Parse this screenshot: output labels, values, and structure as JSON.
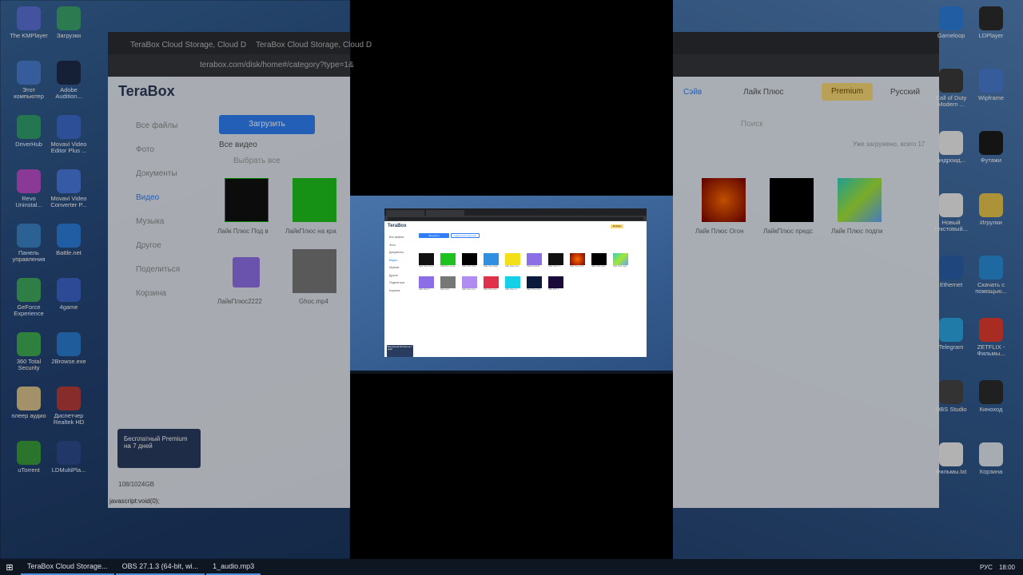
{
  "background": {
    "left_tabs": [
      "TeraBox Cloud Storage, Cloud D",
      "TeraBox Cloud Storage, Cloud D"
    ],
    "left_url": "terabox.com/disk/home#/category?type=1&",
    "left_logo": "TeraBox",
    "left_sidebar": [
      "Все файлы",
      "Фото",
      "Документы",
      "Видео",
      "Музыка",
      "Другое",
      "Поделиться",
      "Корзина"
    ],
    "left_upload": "Загрузить",
    "left_video_all": "Все видео",
    "left_select_all": "Выбрать все",
    "left_captions": [
      "Лайк Плюс Под в",
      "ЛайкПлюс на кра",
      "ЛайкПлюс2222",
      "Ghoc.mp4"
    ],
    "left_promo": "Бесплатный Premium на 7 дней",
    "left_storage": "108/1024GB",
    "left_status": "javascript:void(0);",
    "right_links": [
      "Сэйв"
    ],
    "right_user": "Лайк Плюс",
    "right_premium": "Premium",
    "right_lang": "Русский",
    "right_search": "Поиск",
    "right_loaded": "Уже загружено, всего 17",
    "right_captions": [
      "Лайк Плюс Огон",
      "ЛайкПлюс предс",
      "Лайк Плюс подпи"
    ]
  },
  "desktop_left": [
    {
      "label": "The KMPlayer"
    },
    {
      "label": "Загрузки"
    },
    {
      "label": "Этот компьютер"
    },
    {
      "label": "Adobe Audition..."
    },
    {
      "label": "DriverHub"
    },
    {
      "label": "Movavi Video Editor Plus ..."
    },
    {
      "label": "Revo Uninstal..."
    },
    {
      "label": "Movavi Video Converter P..."
    },
    {
      "label": "Панель управления"
    },
    {
      "label": "Battle.net"
    },
    {
      "label": "GeForce Experience"
    },
    {
      "label": "4game"
    },
    {
      "label": "360 Total Security"
    },
    {
      "label": "2Browse.exe"
    },
    {
      "label": "плеер аудио"
    },
    {
      "label": "Диспетчер Realtek HD"
    },
    {
      "label": "uTorrent"
    },
    {
      "label": "LDMultiPla..."
    }
  ],
  "desktop_right": [
    {
      "label": "Gameloop"
    },
    {
      "label": "LDPlayer"
    },
    {
      "label": "Call of Duty Modern ..."
    },
    {
      "label": "Wipframe"
    },
    {
      "label": "андроид..."
    },
    {
      "label": "Футажи"
    },
    {
      "label": "Новый текстовый..."
    },
    {
      "label": "Игрулки"
    },
    {
      "label": "Ethernet"
    },
    {
      "label": "Скачать с помощью..."
    },
    {
      "label": "Telegram"
    },
    {
      "label": "ZETFLIX - Фильмы..."
    },
    {
      "label": "OBS Studio"
    },
    {
      "label": "Киноход"
    },
    {
      "label": "Фильмы.txt"
    },
    {
      "label": "Корзина"
    }
  ],
  "taskbar": {
    "items": [
      "TeraBox Cloud Storage...",
      "OBS 27.1.3 (64-bit, wi...",
      "1_audio.mp3"
    ],
    "lang": "РУС",
    "time": "18:00"
  },
  "inner": {
    "logo": "TeraBox",
    "sidebar": [
      "Все файлы",
      "Фото",
      "Документы",
      "Видео",
      "Музыка",
      "Другое",
      "Поделиться",
      "Корзина"
    ],
    "upload": "Загрузить",
    "remote": "Удаленная загрузка",
    "premium": "Premium",
    "promo": "Бесплатный Premium на 7 дней",
    "captions_row1": [
      "Лайк Плюс Под в",
      "ЛайкПлюс на кра",
      "Лайк Плюс Огон",
      "Лайк Плюс Кажд",
      "Лайк Плюс Тело",
      "ЛайкПлюс2222",
      "Лайк Плюс Г 1",
      "Лайк Плюс Огон",
      "Лайк Плюс пред",
      "Лайк Плюс подп"
    ],
    "captions_row2": [
      "Лайк Плюс 3",
      "Ghoc.mp4",
      "Лайк Плюс Сон",
      "Лайк Плюс Ком",
      "Лайк Плюс 1 1",
      "Лайк Плюс попу",
      "Лайк 2222 1"
    ]
  }
}
